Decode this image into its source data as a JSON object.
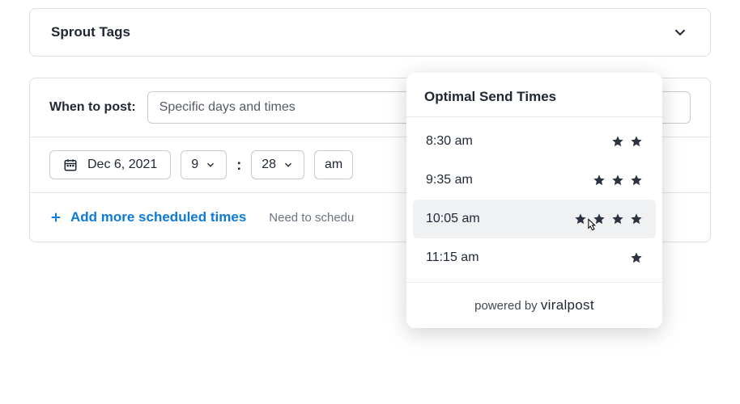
{
  "sproutTags": {
    "label": "Sprout Tags"
  },
  "when": {
    "label": "When to post:",
    "mode": "Specific days and times",
    "date": "Dec 6, 2021",
    "hour": "9",
    "minute": "28",
    "ampm": "am"
  },
  "addMore": {
    "label": "Add more scheduled times",
    "hint": "Need to schedu"
  },
  "popover": {
    "title": "Optimal Send Times",
    "times": [
      {
        "time": "8:30 am",
        "stars": 2,
        "hovered": false
      },
      {
        "time": "9:35 am",
        "stars": 3,
        "hovered": false
      },
      {
        "time": "10:05 am",
        "stars": 4,
        "hovered": true
      },
      {
        "time": "11:15 am",
        "stars": 1,
        "hovered": false
      }
    ],
    "footer": {
      "prefix": "powered by",
      "brand": "viralpost"
    }
  }
}
